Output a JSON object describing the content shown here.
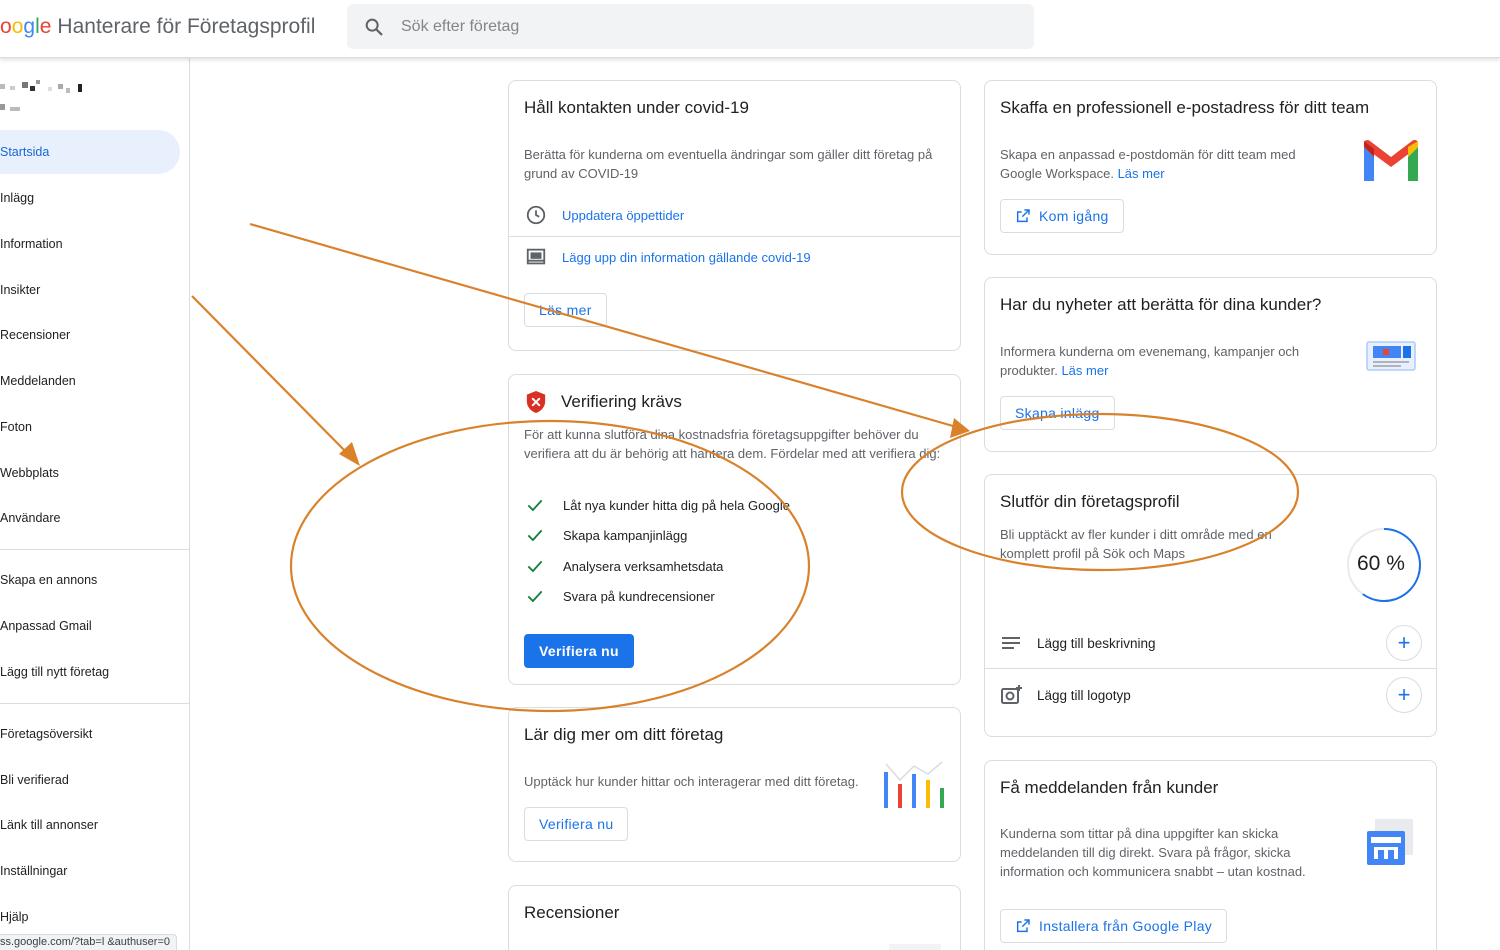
{
  "header": {
    "logo_letters": [
      "o",
      "o",
      "g",
      "l",
      "e"
    ],
    "title": "Hanterare för Företagsprofil",
    "search_placeholder": "Sök efter företag"
  },
  "sidebar": {
    "items": [
      {
        "label": "Startsida",
        "active": true
      },
      {
        "label": "Inlägg"
      },
      {
        "label": "Information"
      },
      {
        "label": "Insikter"
      },
      {
        "label": "Recensioner"
      },
      {
        "label": "Meddelanden"
      },
      {
        "label": "Foton"
      },
      {
        "label": "Webbplats"
      },
      {
        "label": "Användare"
      },
      {
        "label": "Skapa en annons"
      },
      {
        "label": "Anpassad Gmail"
      },
      {
        "label": "Lägg till nytt företag"
      },
      {
        "label": "Företagsöversikt"
      },
      {
        "label": "Bli verifierad"
      },
      {
        "label": "Länk till annonser"
      },
      {
        "label": "Inställningar"
      },
      {
        "label": "Hjälp"
      }
    ],
    "status_url": "ss.google.com/?tab=l &authuser=0"
  },
  "covid_card": {
    "title": "Håll kontakten under covid-19",
    "text": "Berätta för kunderna om eventuella ändringar som gäller ditt företag på grund av COVID-19",
    "link1": "Uppdatera öppettider",
    "link2": "Lägg upp din information gällande covid-19",
    "button": "Läs mer"
  },
  "verify_card": {
    "title": "Verifiering krävs",
    "text": "För att kunna slutföra dina kostnadsfria företagsuppgifter behöver du verifiera att du är behörig att hantera dem. Fördelar med att verifiera dig:",
    "benefits": [
      "Låt nya kunder hitta dig på hela Google",
      "Skapa kampanjinlägg",
      "Analysera verksamhetsdata",
      "Svara på kundrecensioner"
    ],
    "button": "Verifiera nu"
  },
  "learn_card": {
    "title": "Lär dig mer om ditt företag",
    "text": "Upptäck hur kunder hittar och interagerar med ditt företag.",
    "button": "Verifiera nu"
  },
  "reviews_card": {
    "title": "Recensioner"
  },
  "email_card": {
    "title": "Skaffa en professionell e-postadress för ditt team",
    "text": "Skapa en anpassad e-postdomän för ditt team med Google Workspace.",
    "link": "Läs mer",
    "button": "Kom igång"
  },
  "news_card": {
    "title": "Har du nyheter att berätta för dina kunder?",
    "text": "Informera kunderna om evenemang, kampanjer och produkter.",
    "link": "Läs mer",
    "button": "Skapa inlägg"
  },
  "profile_card": {
    "title": "Slutför din företagsprofil",
    "text": "Bli upptäckt av fler kunder i ditt område med en komplett profil på Sök och Maps",
    "progress_label": "60 %",
    "progress": 0.6,
    "task1": "Lägg till beskrivning",
    "task2": "Lägg till logotyp",
    "plus": "+"
  },
  "messages_card": {
    "title": "Få meddelanden från kunder",
    "text": "Kunderna som tittar på dina uppgifter kan skicka meddelanden till dig direkt. Svara på frågor, skicka information och kommunicera snabbt – utan kostnad.",
    "button": "Installera från Google Play"
  },
  "colors": {
    "accent": "#1a73e8",
    "annotation": "#d9822b",
    "check": "#188038",
    "alert": "#d93025"
  }
}
